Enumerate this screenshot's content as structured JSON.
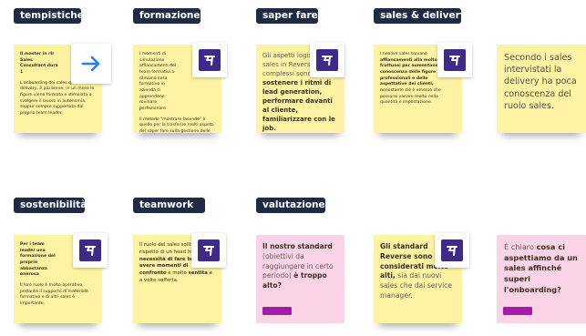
{
  "tags": {
    "tempistiche": "tempistiche",
    "formazione": "formazione",
    "saper_fare": "saper fare",
    "sales_delivery": "sales & delivery",
    "sostenibilita": "sostenibilità",
    "teamwork": "teamwork",
    "valutazione": "valutazione"
  },
  "notes": {
    "n1": {
      "p1": "Il master in rIr Sales Consultant dura 1",
      "p2": "L'onboarding dei sales quello di un delivery, è più breve: in un mese le figure viene formata e stimolata a svolgere il lavoro in autonomia, seppur sempre supportata dal proprio team leader."
    },
    "n2": {
      "p1": "I momenti di simulazione affiancamenti del team formativi a rilevano cosa formativo in azienda ci apprendono rovinare perfezionare",
      "p2": "Il metodo \"mostrare facendo\" è quello per la trasferire molti aspetti del saper fare sulla gestione delle domande, evitando informazioni scorrette da un'operatore."
    },
    "n3": {
      "pre": "Gli aspetti logistici sales in Reverse so complessi sono:",
      "bold": "sostenere i ritmi di lead generation, performare davanti al cliente, familiarizzare con le job."
    },
    "n4": {
      "pre": "I neolive sales trovano",
      "bold": "affiancamenti alla molto fruttuosi per aumentano la conoscenza delle figure professionali e delle aspettative dei clienti,",
      "post": "nonostante ciò è emerso che possono variare molto nella quantità e impostazione."
    },
    "n5": {
      "text": "Secondo i sales intervistati la delivery ha poca conoscenza del ruolo sales."
    },
    "n6": {
      "p1": "Per i team leader una formazione del proprio abbastanza onerosa",
      "p2": "Il loro ruolo è molto operativo, pertanto il supporto di materiale formativo e di altri sales è importante."
    },
    "n7": {
      "pre": "Il ruolo del sales solitario rispetto di un head hunt",
      "bold1": "la necessità di fare team e avere momenti di confronto",
      "mid": "è molto",
      "bold2": "sentita",
      "post": "e a volte sofferta."
    },
    "n8": {
      "bold": "Il nostro standard",
      "post": "(obiettivi da raggiungere in certo periodo)",
      "bold2": "è troppo alto?"
    },
    "n9": {
      "bold": "Gli standard Reverse sono considerati molto alti,",
      "post": "sia dai nuovi sales che dai service manager."
    },
    "n10": {
      "pre": "È chiaro",
      "bold": "cosa ci aspettiamo da un sales affinché superi l'onboarding?"
    }
  },
  "icons": {
    "arrow": "arrow-right-icon",
    "logo": "reverse-logo-icon"
  },
  "colors": {
    "tag_bg": "#1f2a44",
    "note_yellow": "#fdf3a3",
    "note_pink": "#fbd3e6",
    "logo_purple": "#3d2a8a",
    "arrow_blue": "#2f7bf5",
    "accent_bar": "#a31fa8"
  }
}
